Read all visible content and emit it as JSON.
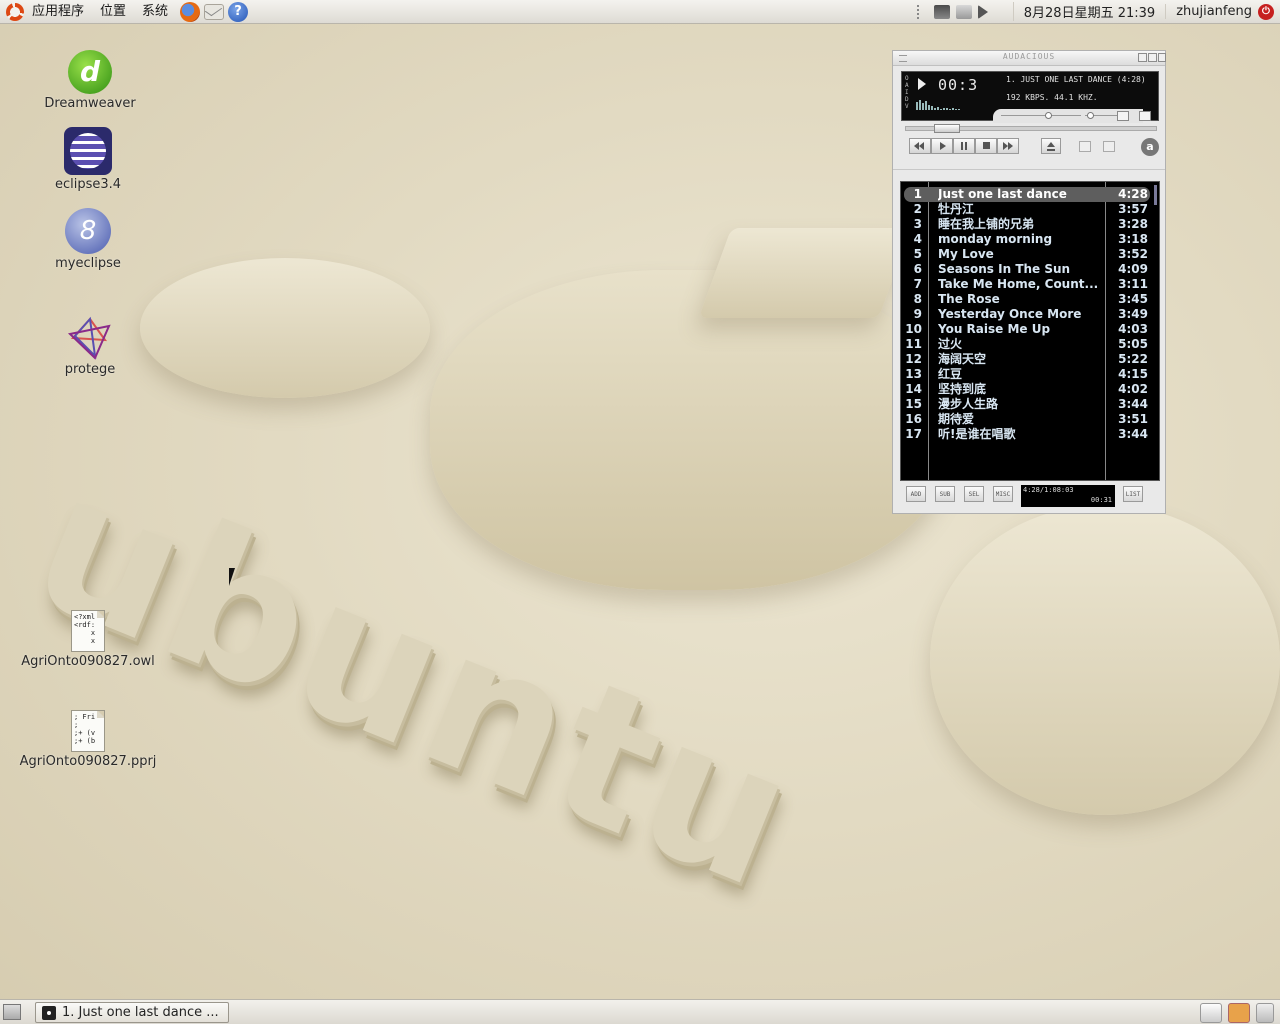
{
  "top_panel": {
    "menus": [
      "应用程序",
      "位置",
      "系统"
    ],
    "launchers": [
      "firefox-icon",
      "mail-icon",
      "help-icon"
    ],
    "help_glyph": "?",
    "clock": "8月28日星期五 21:39",
    "user": "zhujianfeng"
  },
  "desktop": {
    "wallpaper_text": "ubuntu",
    "icons": [
      {
        "label": "Dreamweaver",
        "glyph": "d"
      },
      {
        "label": "eclipse3.4"
      },
      {
        "label": "myeclipse",
        "glyph": "8"
      },
      {
        "label": "protege"
      },
      {
        "label": "AgriOnto090827.owl",
        "preview": "<?xml\n<rdf:\n    x\n    x"
      },
      {
        "label": "AgriOnto090827.pprj",
        "preview": "; Fri\n;\n;+ (v\n;+ (b"
      }
    ]
  },
  "player": {
    "title": "AUDACIOUS",
    "side_letters": "OAIDV",
    "time": "00:3",
    "song": "1. JUST ONE LAST DANCE (4:28)",
    "bitrate": "192 KBPS. 44.1 KHZ.",
    "logo_letter": "a",
    "playlist": [
      {
        "num": "1",
        "title": "Just one last dance",
        "dur": "4:28",
        "selected": true
      },
      {
        "num": "2",
        "title": "牡丹江",
        "dur": "3:57"
      },
      {
        "num": "3",
        "title": "睡在我上铺的兄弟",
        "dur": "3:28"
      },
      {
        "num": "4",
        "title": "monday morning",
        "dur": "3:18"
      },
      {
        "num": "5",
        "title": "My Love",
        "dur": "3:52"
      },
      {
        "num": "6",
        "title": "Seasons In The Sun",
        "dur": "4:09"
      },
      {
        "num": "7",
        "title": "Take Me Home, Count...",
        "dur": "3:11"
      },
      {
        "num": "8",
        "title": "The Rose",
        "dur": "3:45"
      },
      {
        "num": "9",
        "title": "Yesterday Once More",
        "dur": "3:49"
      },
      {
        "num": "10",
        "title": "You Raise Me Up",
        "dur": "4:03"
      },
      {
        "num": "11",
        "title": "过火",
        "dur": "5:05"
      },
      {
        "num": "12",
        "title": "海阔天空",
        "dur": "5:22"
      },
      {
        "num": "13",
        "title": "红豆",
        "dur": "4:15"
      },
      {
        "num": "14",
        "title": "坚持到底",
        "dur": "4:02"
      },
      {
        "num": "15",
        "title": "漫步人生路",
        "dur": "3:44"
      },
      {
        "num": "16",
        "title": "期待爱",
        "dur": "3:51"
      },
      {
        "num": "17",
        "title": "听!是谁在唱歌",
        "dur": "3:44"
      }
    ],
    "pl_buttons": {
      "add": "ADD",
      "sub": "SUB",
      "sel": "SEL",
      "misc": "MISC",
      "list": "LIST"
    },
    "mini_total": "4:28/1:08:03",
    "mini_time": "00:31"
  },
  "taskbar": {
    "task_label": "1. Just one last dance ..."
  }
}
